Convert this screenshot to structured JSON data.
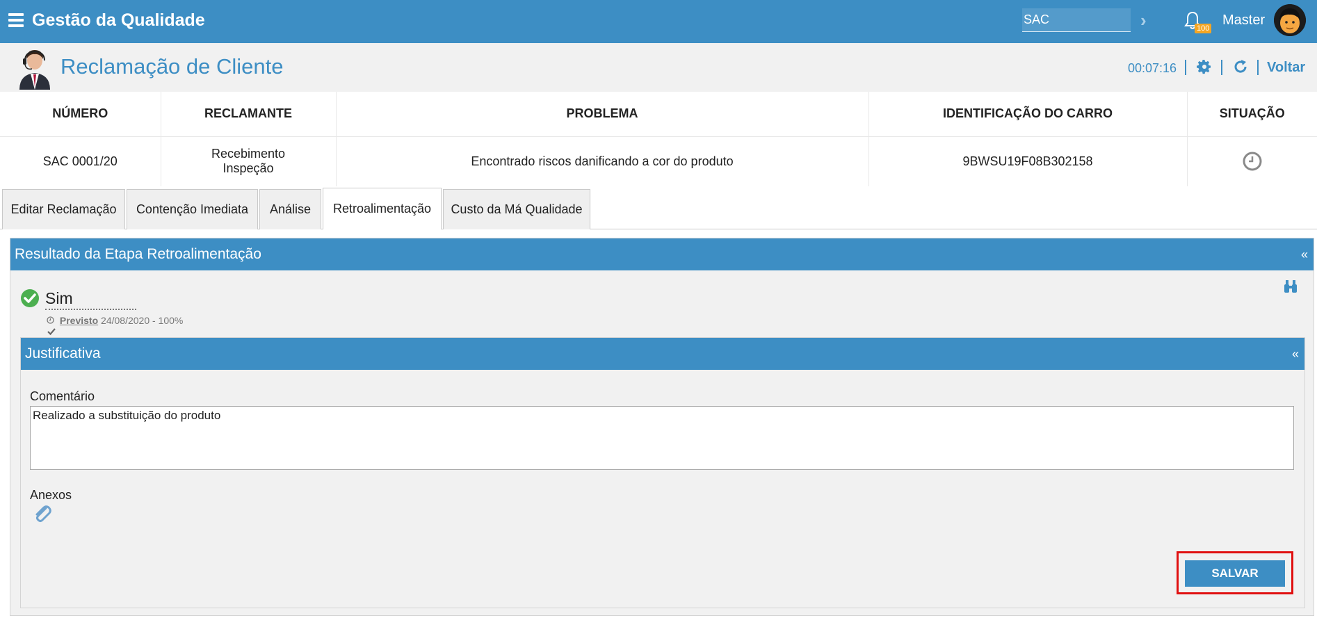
{
  "navbar": {
    "app_title": "Gestão da Qualidade",
    "module_value": "SAC",
    "notification_count": "100",
    "user_name": "Master"
  },
  "header": {
    "page_title": "Reclamação de Cliente",
    "timer": "00:07:16",
    "back_label": "Voltar"
  },
  "summary": {
    "columns": [
      "NÚMERO",
      "RECLAMANTE",
      "PROBLEMA",
      "IDENTIFICAÇÃO DO CARRO",
      "SITUAÇÃO"
    ],
    "row": {
      "numero": "SAC 0001/20",
      "reclamante_line1": "Recebimento",
      "reclamante_line2": "Inspeção",
      "problema": "Encontrado riscos danificando a cor do produto",
      "identificacao": "9BWSU19F08B302158"
    }
  },
  "tabs": [
    {
      "label": "Editar Reclamação"
    },
    {
      "label": "Contenção Imediata"
    },
    {
      "label": "Análise"
    },
    {
      "label": "Retroalimentação"
    },
    {
      "label": "Custo da Má Qualidade"
    }
  ],
  "active_tab": "Retroalimentação",
  "result_panel": {
    "title": "Resultado da Etapa Retroalimentação",
    "collapse": "«",
    "value": "Sim",
    "forecast_label": "Previsto",
    "forecast_value": "24/08/2020 - 100%"
  },
  "justification_panel": {
    "title": "Justificativa",
    "collapse": "«",
    "comment_label": "Comentário",
    "comment_value": "Realizado a substituição do produto",
    "attachments_label": "Anexos",
    "save_label": "SALVAR"
  },
  "colors": {
    "primary": "#3d8ec4",
    "success": "#4caf50",
    "highlight": "#e01010",
    "badge": "#f5a623"
  }
}
